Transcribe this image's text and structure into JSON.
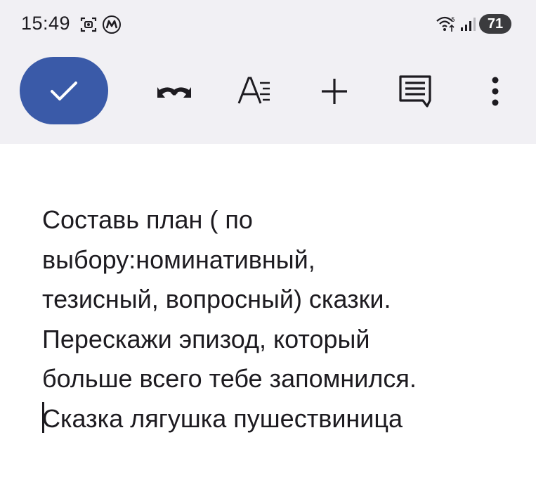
{
  "status_bar": {
    "time": "15:49",
    "battery_level": "71",
    "icons": [
      "screenshot-icon",
      "app-notification-icon",
      "wifi-icon",
      "signal-icon",
      "battery-icon"
    ]
  },
  "toolbar": {
    "accent_color": "#3a5aa8",
    "buttons": [
      "check-icon",
      "undo-redo-icon",
      "text-format-icon",
      "add-icon",
      "comment-icon",
      "more-vert-icon"
    ]
  },
  "document": {
    "lines": [
      "Составь план ( по",
      "выбору:номинативный,",
      "тезисный, вопросный) сказки.",
      "Перескажи эпизод, который",
      "больше всего тебе запомнился.",
      "Сказка лягушка пушествиница"
    ]
  }
}
